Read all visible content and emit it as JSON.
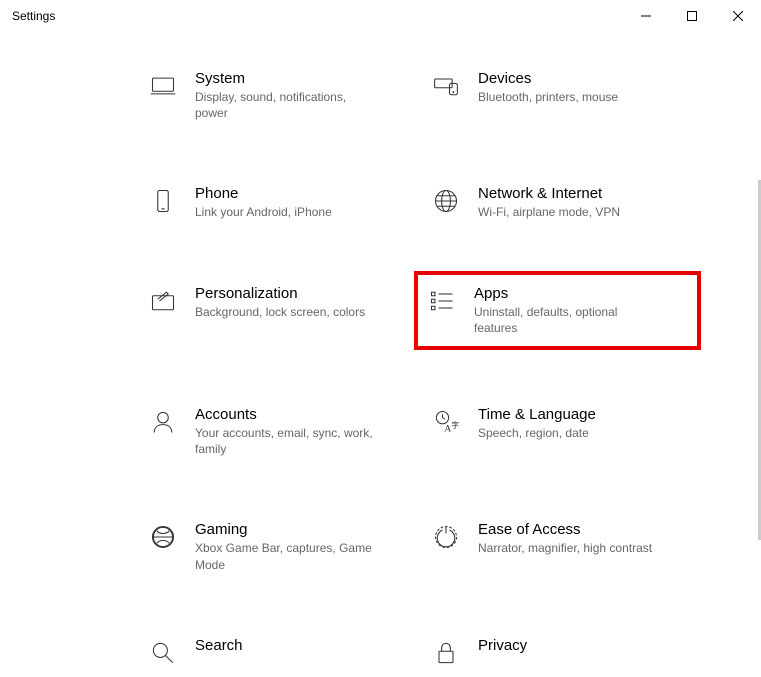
{
  "window": {
    "title": "Settings"
  },
  "categories": [
    {
      "id": "system",
      "title": "System",
      "desc": "Display, sound, notifications, power",
      "highlight": false
    },
    {
      "id": "devices",
      "title": "Devices",
      "desc": "Bluetooth, printers, mouse",
      "highlight": false
    },
    {
      "id": "phone",
      "title": "Phone",
      "desc": "Link your Android, iPhone",
      "highlight": false
    },
    {
      "id": "network",
      "title": "Network & Internet",
      "desc": "Wi-Fi, airplane mode, VPN",
      "highlight": false
    },
    {
      "id": "personalization",
      "title": "Personalization",
      "desc": "Background, lock screen, colors",
      "highlight": false
    },
    {
      "id": "apps",
      "title": "Apps",
      "desc": "Uninstall, defaults, optional features",
      "highlight": true
    },
    {
      "id": "accounts",
      "title": "Accounts",
      "desc": "Your accounts, email, sync, work, family",
      "highlight": false
    },
    {
      "id": "time",
      "title": "Time & Language",
      "desc": "Speech, region, date",
      "highlight": false
    },
    {
      "id": "gaming",
      "title": "Gaming",
      "desc": "Xbox Game Bar, captures, Game Mode",
      "highlight": false
    },
    {
      "id": "ease",
      "title": "Ease of Access",
      "desc": "Narrator, magnifier, high contrast",
      "highlight": false
    },
    {
      "id": "search",
      "title": "Search",
      "desc": "",
      "highlight": false
    },
    {
      "id": "privacy",
      "title": "Privacy",
      "desc": "",
      "highlight": false
    }
  ]
}
